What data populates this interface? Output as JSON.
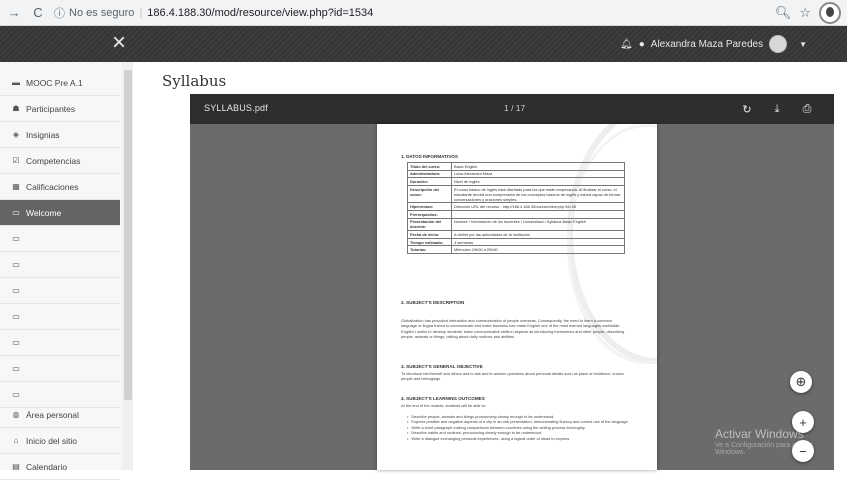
{
  "browser": {
    "security_label": "No es seguro",
    "url": "186.4.188.30/mod/resource/view.php?id=1534"
  },
  "topbar": {
    "close_glyph": "×",
    "user_name": "Alexandra Maza Paredes"
  },
  "sidebar": {
    "items": [
      {
        "label": "MOOC Pre A.1",
        "icon": "mortarboard-icon",
        "glyph": "▬"
      },
      {
        "label": "Participantes",
        "icon": "users-icon",
        "glyph": "☗"
      },
      {
        "label": "Insignias",
        "icon": "badge-icon",
        "glyph": "◈"
      },
      {
        "label": "Competencias",
        "icon": "checklist-icon",
        "glyph": "☑"
      },
      {
        "label": "Calificaciones",
        "icon": "table-icon",
        "glyph": "▦"
      },
      {
        "label": "Welcome",
        "icon": "folder-icon",
        "glyph": "▭",
        "active": true
      },
      {
        "label": "",
        "icon": "folder-icon",
        "glyph": "▭"
      },
      {
        "label": "",
        "icon": "folder-icon",
        "glyph": "▭"
      },
      {
        "label": "",
        "icon": "folder-icon",
        "glyph": "▭"
      },
      {
        "label": "",
        "icon": "folder-icon",
        "glyph": "▭"
      },
      {
        "label": "",
        "icon": "folder-icon",
        "glyph": "▭"
      },
      {
        "label": "",
        "icon": "folder-icon",
        "glyph": "▭"
      },
      {
        "label": "",
        "icon": "folder-icon",
        "glyph": "▭"
      },
      {
        "label": "Área personal",
        "icon": "dashboard-icon",
        "glyph": "◍"
      },
      {
        "label": "Inicio del sitio",
        "icon": "home-icon",
        "glyph": "⌂"
      },
      {
        "label": "Calendario",
        "icon": "calendar-icon",
        "glyph": "▤"
      }
    ]
  },
  "main": {
    "title": "Syllabus"
  },
  "viewer": {
    "file_name": "SYLLABUS.pdf",
    "page_indicator": "1 / 17"
  },
  "doc": {
    "section1": "1.   DATOS INFORMATIVOS",
    "table": [
      [
        "Título del curso:",
        "Basic English"
      ],
      [
        "Administradora:",
        "Luisa Alexandra Maza"
      ],
      [
        "Duración:",
        "Nivel de Inglés"
      ],
      [
        "Descripción del curso:",
        "El curso básico de inglés está diseñado para los que están empezando. Al finalizar el curso, el estudiante tendrá una comprensión de los conceptos básicos de inglés y estará capaz de formar conversaciones y oraciones simples."
      ],
      [
        "Hiperenlace:",
        "Dirección URL del recurso - http://186.4.188.30/course/view.php?id=28"
      ],
      [
        "Prerrequisitos:",
        ""
      ],
      [
        "Presentación del docente:",
        "Nombre / Información de los docentes / Universidad / Syllabus Basic English"
      ],
      [
        "Fecha de inicio:",
        "A definir por las autoridades de la institución"
      ],
      [
        "Tiempo estimado:",
        "4 semanas"
      ],
      [
        "Tutorías:",
        "Miércoles 19h00 a 20h00"
      ]
    ],
    "section2": "2.   SUBJECT'S DESCRIPTION",
    "para2": "Globalization has provoked interaction and communication of people overseas. Consequently, the need to learn a common language or lingua franca to communicate and make business has made English one of the most learned languages worldwide. English I seeks to develop students' basic communicative skills in aspects as introducing themselves and other people, describing people, animals or things, talking about daily routines and abilities.",
    "section3": "3.   SUBJECT'S GENERAL OBJECTIVE",
    "para3": "To introduce him/herself and others and to ask and to answer questions about personal details such as place of residence, known people and belongings.",
    "section4": "4.   SUBJECT'S LEARNING OUTCOMES",
    "para4": "At the end of the module, students will be able to:",
    "bullets": [
      "Describe people, animals and things pronouncing clearly enough to be understood.",
      "Express positive and negative aspects of a city in an oral presentation, demonstrating fluency and correct use of the language.",
      "Write a short paragraph making comparisons between countries using the writing process thoroughly.",
      "Describe habits and routines, pronouncing clearly enough to be understood.",
      "Write a dialogue exchanging personal experiences, using a logical order of ideas to express"
    ]
  },
  "watermark": {
    "title": "Activar Windows",
    "subtitle": "Ve a Configuración para activar Windows."
  }
}
